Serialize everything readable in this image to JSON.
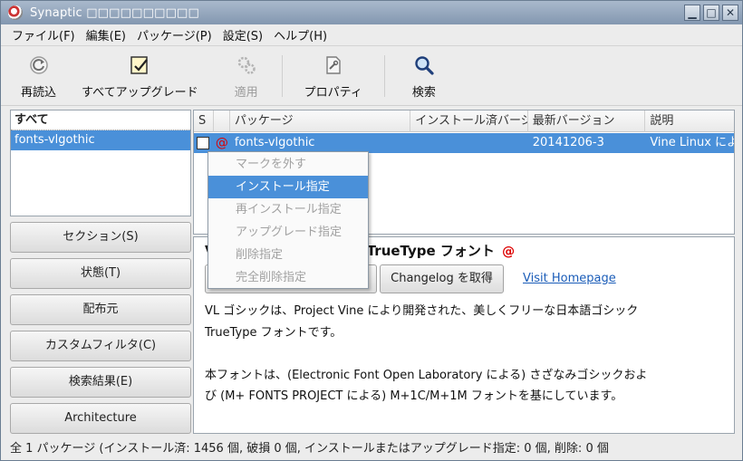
{
  "window": {
    "title": "Synaptic □□□□□□□□□□",
    "buttons": {
      "minimize": "▁",
      "maximize": "□",
      "close": "✕"
    }
  },
  "menubar": [
    "ファイル(F)",
    "編集(E)",
    "パッケージ(P)",
    "設定(S)",
    "ヘルプ(H)"
  ],
  "toolbar": {
    "reload": "再読込",
    "upgrade_all": "すべてアップグレード",
    "apply": "適用",
    "properties": "プロパティ",
    "search": "検索"
  },
  "filters": {
    "header": "すべて",
    "selected": "fonts-vlgothic"
  },
  "side_buttons": [
    "セクション(S)",
    "状態(T)",
    "配布元",
    "カスタムフィルタ(C)",
    "検索結果(E)",
    "Architecture"
  ],
  "table": {
    "columns": [
      "S",
      "",
      "パッケージ",
      "インストール済バージョン",
      "最新バージョン",
      "説明"
    ],
    "row": {
      "package": "fonts-vlgothic",
      "installed": "",
      "latest": "20141206-3",
      "description": "Vine Linux による"
    }
  },
  "context_menu": [
    {
      "label": "マークを外す",
      "enabled": false
    },
    {
      "label": "インストール指定",
      "enabled": true
    },
    {
      "label": "再インストール指定",
      "enabled": false
    },
    {
      "label": "アップグレード指定",
      "enabled": false
    },
    {
      "label": "削除指定",
      "enabled": false
    },
    {
      "label": "完全削除指定",
      "enabled": false
    }
  ],
  "details": {
    "title_visible": "V                                TrueType フォント",
    "changelog_button": "Changelog を取得",
    "homepage_link": "Visit Homepage",
    "description_lines": [
      "VL ゴシックは、Project Vine により開発された、美しくフリーな日本語ゴシック",
      "TrueType フォントです。",
      "",
      "本フォントは、(Electronic Font Open Laboratory による) さざなみゴシックおよ",
      "び (M+ FONTS PROJECT による) M+1C/M+1M フォントを基にしています。"
    ]
  },
  "status": "全 1 パッケージ (インストール済: 1456 個, 破損 0 個, インストールまたはアップグレード指定: 0 個, 削除: 0 個",
  "colors": {
    "selection": "#4a90d9",
    "titlebar": "#8397b0",
    "link": "#1a5cb8",
    "debian_swirl": "#dd0000"
  }
}
